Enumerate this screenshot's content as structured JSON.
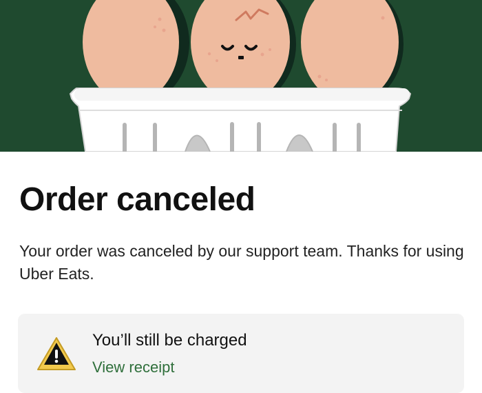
{
  "hero": {
    "illustration": "eggs-in-carton-illustration",
    "background_color": "#1f4a2f"
  },
  "order_status": {
    "title": "Order canceled",
    "message": "Your order was canceled by our support team. Thanks for using Uber Eats."
  },
  "charge_notice": {
    "icon": "warning-icon",
    "title": "You’ll still be charged",
    "link_label": "View receipt",
    "link_color": "#2f6f3b"
  }
}
